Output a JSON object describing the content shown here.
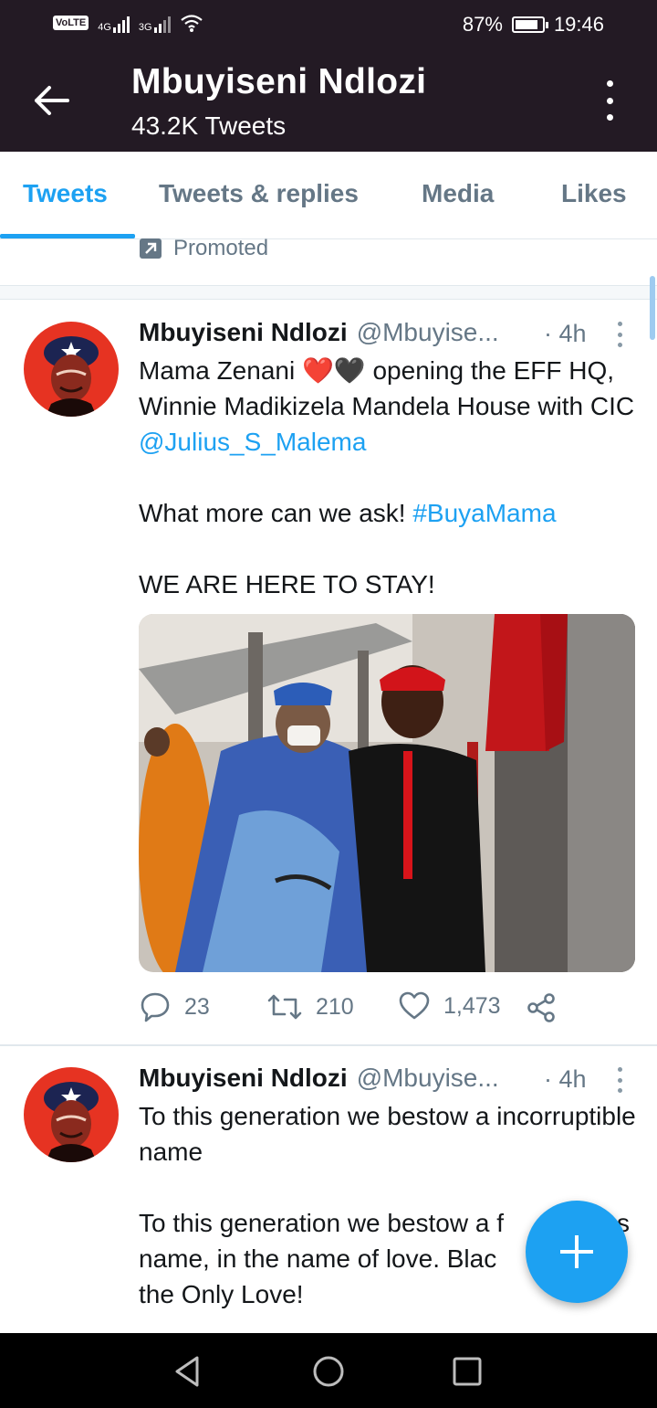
{
  "status_bar": {
    "volte": "VoLTE",
    "sim1": "1",
    "net1": "4G",
    "net2": "3G",
    "battery": "87%",
    "battery_level": 0.87,
    "time": "19:46"
  },
  "header": {
    "title": "Mbuyiseni Ndlozi",
    "subtitle": "43.2K Tweets",
    "back_icon": "arrow-left-icon",
    "more_icon": "more-vertical-icon"
  },
  "tabs": [
    {
      "label": "Tweets",
      "active": true
    },
    {
      "label": "Tweets & replies",
      "active": false
    },
    {
      "label": "Media",
      "active": false
    },
    {
      "label": "Likes",
      "active": false
    }
  ],
  "promoted": {
    "label": "Promoted",
    "icon": "promoted-arrow-icon"
  },
  "tweets": [
    {
      "name": "Mbuyiseni Ndlozi",
      "handle": "@Mbuyise...",
      "time": "· 4h",
      "text_line1": "Mama Zenani ❤️🖤 opening the EFF HQ, Winnie Madikizela Mandela House with CIC ",
      "mention": "@Julius_S_Malema",
      "text_line2": "What more can we ask! ",
      "hashtag": "#BuyaMama",
      "text_line3": "WE ARE HERE TO STAY!",
      "replies": "23",
      "retweets": "210",
      "likes": "1,473"
    },
    {
      "name": "Mbuyiseni Ndlozi",
      "handle": "@Mbuyise...",
      "time": "· 4h",
      "text_line1": "To this generation we bestow a incorruptible name",
      "text_line2": "To this generation we bestow a f",
      "text_line2_tail": "s",
      "text_line3": "name, in the name of love. Blac",
      "text_line4": "the Only Love!"
    }
  ],
  "colors": {
    "header_bg": "#231a24",
    "accent": "#1da1f2",
    "muted": "#657786",
    "heart": "#e0245e"
  }
}
